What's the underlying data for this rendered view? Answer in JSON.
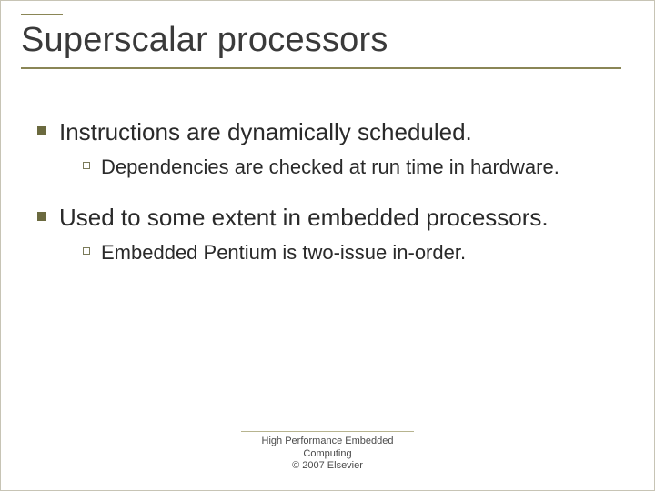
{
  "slide": {
    "title": "Superscalar processors",
    "bullets": [
      {
        "text": "Instructions are dynamically scheduled.",
        "sub": [
          "Dependencies are checked at run time in hardware."
        ]
      },
      {
        "text": "Used to some extent in embedded processors.",
        "sub": [
          "Embedded Pentium is two-issue in-order."
        ]
      }
    ],
    "footer": {
      "line1": "High Performance Embedded",
      "line2": "Computing",
      "line3": "© 2007 Elsevier"
    }
  }
}
